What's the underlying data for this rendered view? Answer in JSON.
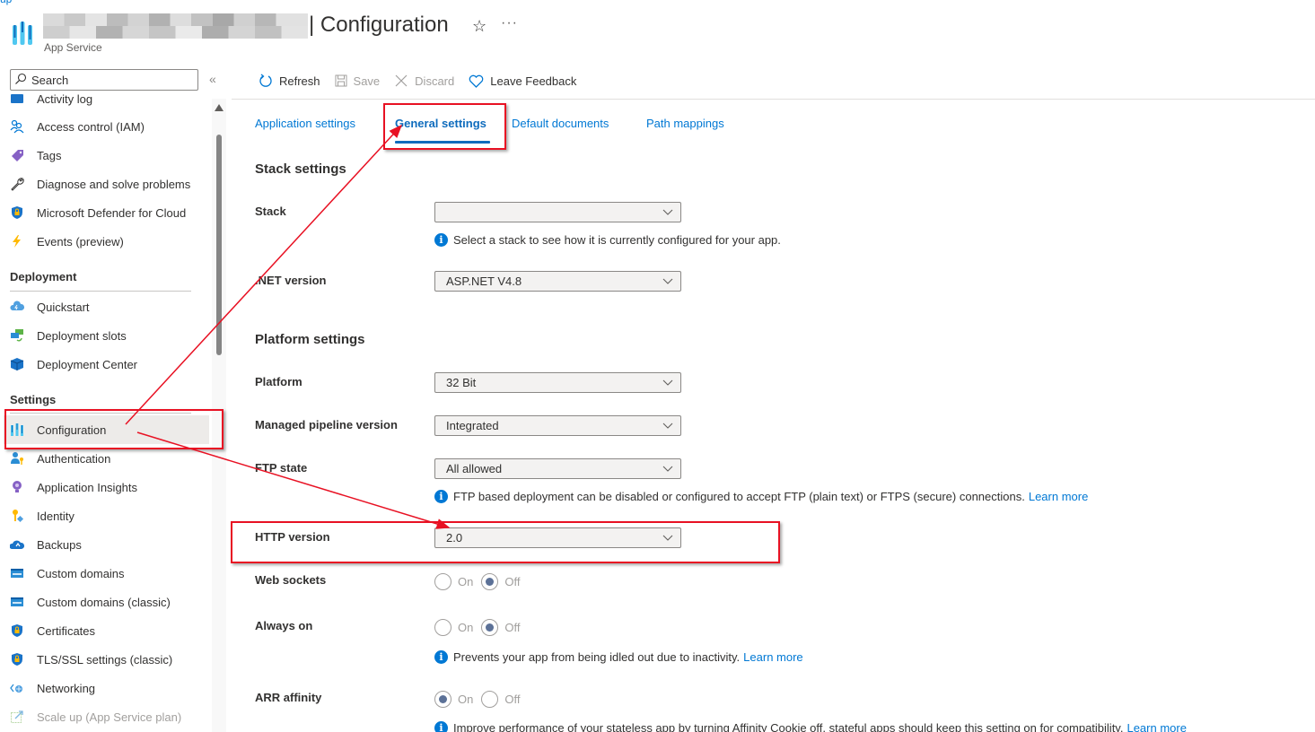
{
  "header": {
    "top_link": "up",
    "title": "| Configuration",
    "subtitle": "App Service",
    "favorite_icon": "star-icon",
    "more_icon": "more-icon"
  },
  "sidebar": {
    "search_placeholder": "Search",
    "collapse_icon": "double-chevron-left-icon",
    "items_top": [
      {
        "label": "Activity log",
        "icon": "activity-log-icon"
      },
      {
        "label": "Access control (IAM)",
        "icon": "people-icon"
      },
      {
        "label": "Tags",
        "icon": "tag-icon"
      },
      {
        "label": "Diagnose and solve problems",
        "icon": "wrench-icon"
      },
      {
        "label": "Microsoft Defender for Cloud",
        "icon": "shield-icon"
      },
      {
        "label": "Events (preview)",
        "icon": "lightning-icon"
      }
    ],
    "sections": [
      {
        "title": "Deployment",
        "items": [
          {
            "label": "Quickstart",
            "icon": "cloud-icon"
          },
          {
            "label": "Deployment slots",
            "icon": "slots-icon"
          },
          {
            "label": "Deployment Center",
            "icon": "cube-icon"
          }
        ]
      },
      {
        "title": "Settings",
        "items": [
          {
            "label": "Configuration",
            "icon": "configuration-icon",
            "active": true
          },
          {
            "label": "Authentication",
            "icon": "user-key-icon"
          },
          {
            "label": "Application Insights",
            "icon": "lightbulb-icon"
          },
          {
            "label": "Identity",
            "icon": "key-icon"
          },
          {
            "label": "Backups",
            "icon": "cloud-backup-icon"
          },
          {
            "label": "Custom domains",
            "icon": "www-icon"
          },
          {
            "label": "Custom domains (classic)",
            "icon": "www-icon"
          },
          {
            "label": "Certificates",
            "icon": "shield-lock-icon"
          },
          {
            "label": "TLS/SSL settings (classic)",
            "icon": "shield-lock-icon"
          },
          {
            "label": "Networking",
            "icon": "network-icon"
          },
          {
            "label": "Scale up (App Service plan)",
            "icon": "scale-up-icon",
            "disabled": true
          }
        ]
      }
    ]
  },
  "toolbar": {
    "refresh": "Refresh",
    "save": "Save",
    "discard": "Discard",
    "feedback": "Leave Feedback"
  },
  "tabs": [
    {
      "label": "Application settings",
      "active": false
    },
    {
      "label": "General settings",
      "active": true
    },
    {
      "label": "Default documents",
      "active": false
    },
    {
      "label": "Path mappings",
      "active": false
    }
  ],
  "stack_settings": {
    "title": "Stack settings",
    "stack": {
      "label": "Stack",
      "value": "",
      "info": "Select a stack to see how it is currently configured for your app."
    },
    "net_version": {
      "label": ".NET version",
      "value": "ASP.NET V4.8"
    }
  },
  "platform_settings": {
    "title": "Platform settings",
    "platform": {
      "label": "Platform",
      "value": "32 Bit"
    },
    "pipeline": {
      "label": "Managed pipeline version",
      "value": "Integrated"
    },
    "ftp": {
      "label": "FTP state",
      "value": "All allowed",
      "info": "FTP based deployment can be disabled or configured to accept FTP (plain text) or FTPS (secure) connections.",
      "link": "Learn more"
    },
    "http": {
      "label": "HTTP version",
      "value": "2.0"
    },
    "web_sockets": {
      "label": "Web sockets",
      "on": "On",
      "off": "Off",
      "selected": "Off"
    },
    "always_on": {
      "label": "Always on",
      "on": "On",
      "off": "Off",
      "selected": "Off",
      "info": "Prevents your app from being idled out due to inactivity.",
      "link": "Learn more"
    },
    "arr": {
      "label": "ARR affinity",
      "on": "On",
      "off": "Off",
      "selected": "On",
      "info": "Improve performance of your stateless app by turning Affinity Cookie off, stateful apps should keep this setting on for compatibility.",
      "link": "Learn more"
    }
  },
  "colors": {
    "accent": "#0078d4",
    "annotation": "#e81123"
  }
}
